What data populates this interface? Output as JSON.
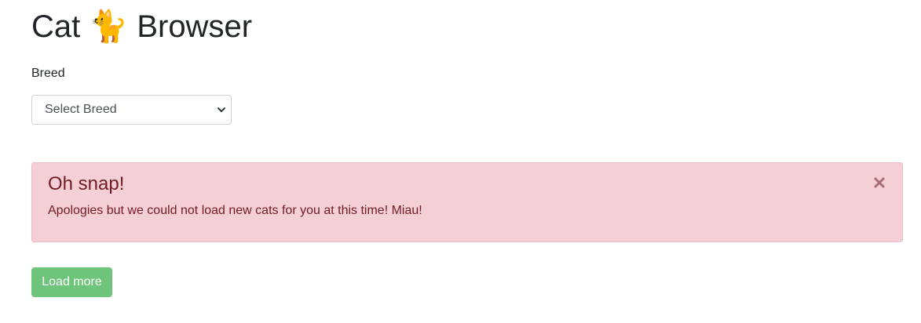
{
  "header": {
    "title_before": "Cat",
    "title_emoji": "🐈",
    "title_after": "Browser"
  },
  "filter": {
    "label": "Breed",
    "selected": "Select Breed",
    "icon": "chevron-down-icon"
  },
  "alert": {
    "heading": "Oh snap!",
    "message": "Apologies but we could not load new cats for you at this time! Miau!",
    "close_icon": "close-icon"
  },
  "actions": {
    "load_more_label": "Load more"
  },
  "colors": {
    "alert_background": "#f4cfd5",
    "alert_text": "#721c24",
    "button_background": "#6fc47c"
  }
}
